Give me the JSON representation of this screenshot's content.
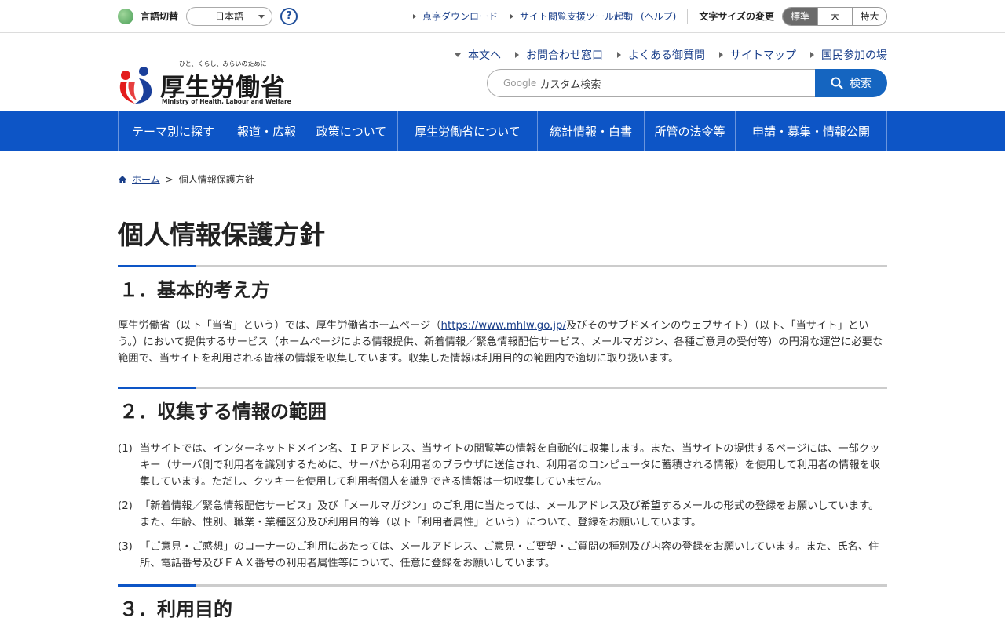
{
  "utility": {
    "lang_label": "言語切替",
    "lang_value": "日本語",
    "help_mark": "?",
    "links": [
      "点字ダウンロード",
      "サイト閲覧支援ツール起動"
    ],
    "help_link": "(ヘルプ)",
    "fontsize_label": "文字サイズの変更",
    "fontsize_options": [
      "標準",
      "大",
      "特大"
    ]
  },
  "header": {
    "logo_tagline": "ひと、くらし、みらいのために",
    "logo_text": "厚生労働省",
    "logo_en": "Ministry of Health, Labour and Welfare",
    "nav": [
      "本文へ",
      "お問合わせ窓口",
      "よくある御質問",
      "サイトマップ",
      "国民参加の場"
    ],
    "search_google": "Google",
    "search_placeholder": "カスタム検索",
    "search_button": "検索"
  },
  "gnav": [
    "テーマ別に探す",
    "報道・広報",
    "政策について",
    "厚生労働省について",
    "統計情報・白書",
    "所管の法令等",
    "申請・募集・情報公開"
  ],
  "breadcrumb": {
    "home": "ホーム",
    "sep": ">",
    "current": "個人情報保護方針"
  },
  "page": {
    "title": "個人情報保護方針",
    "s1_title": "１．基本的考え方",
    "s1_text_a": "厚生労働省（以下「当省」という）では、厚生労働省ホームページ（",
    "s1_link": "https://www.mhlw.go.jp/",
    "s1_text_b": "及びそのサブドメインのウェブサイト）（以下、「当サイト」という。）において提供するサービス（ホームページによる情報提供、新着情報／緊急情報配信サービス、メールマガジン、各種ご意見の受付等）の円滑な運営に必要な範囲で、当サイトを利用される皆様の情報を収集しています。収集した情報は利用目的の範囲内で適切に取り扱います。",
    "s2_title": "２．収集する情報の範囲",
    "s2_items": [
      {
        "num": "(1)",
        "text": "当サイトでは、インターネットドメイン名、ＩＰアドレス、当サイトの閲覧等の情報を自動的に収集します。また、当サイトの提供するページには、一部クッキー（サーバ側で利用者を識別するために、サーバから利用者のブラウザに送信され、利用者のコンピュータに蓄積される情報）を使用して利用者の情報を収集しています。ただし、クッキーを使用して利用者個人を識別できる情報は一切収集していません。"
      },
      {
        "num": "(2)",
        "text": "「新着情報／緊急情報配信サービス」及び「メールマガジン」のご利用に当たっては、メールアドレス及び希望するメールの形式の登録をお願いしています。また、年齢、性別、職業・業種区分及び利用目的等（以下「利用者属性」という）について、登録をお願いしています。"
      },
      {
        "num": "(3)",
        "text": "「ご意見・ご感想」のコーナーのご利用にあたっては、メールアドレス、ご意見・ご要望・ご質問の種別及び内容の登録をお願いしています。また、氏名、住所、電話番号及びＦＡＸ番号の利用者属性等について、任意に登録をお願いしています。"
      }
    ],
    "s3_title": "３．利用目的"
  }
}
